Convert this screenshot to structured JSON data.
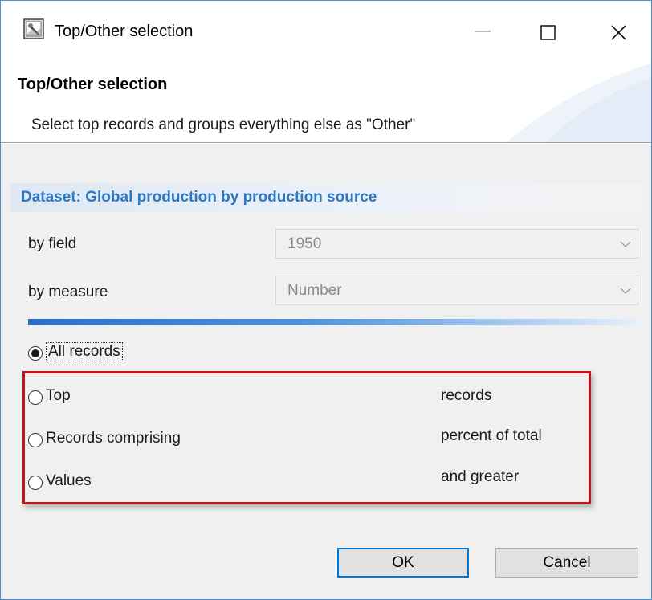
{
  "window": {
    "title": "Top/Other selection",
    "icon": "app-wizard-icon"
  },
  "banner": {
    "title": "Top/Other selection",
    "description": "Select top records and groups everything else as \"Other\""
  },
  "dataset": {
    "label": "Dataset: Global production by production source"
  },
  "fields": {
    "by_field_label": "by field",
    "by_field_value": "1950",
    "by_measure_label": "by measure",
    "by_measure_value": "Number"
  },
  "options": {
    "all_records": "All records",
    "top": "Top",
    "top_suffix": "records",
    "records_comprising": "Records comprising",
    "records_comprising_suffix": "percent of total",
    "values": "Values",
    "values_suffix": "and greater",
    "selected": "All records"
  },
  "buttons": {
    "ok": "OK",
    "cancel": "Cancel"
  },
  "colors": {
    "dataset_label": "#2b78c5",
    "highlight_border": "#c0151a",
    "default_button_border": "#0078d7"
  }
}
